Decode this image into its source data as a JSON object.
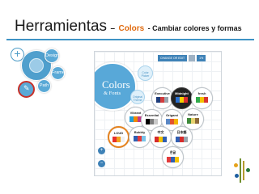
{
  "slide": {
    "title": "Herramientas",
    "dash": "–",
    "accent": "Colors",
    "subtitle": "- Cambiar colores y formas",
    "accent_color": "#e06b10",
    "rule_color": "#3e93c5"
  },
  "left_menu": {
    "plus_label": "+",
    "items": [
      {
        "label": "Design"
      },
      {
        "label": "Frame"
      },
      {
        "label": "Path"
      }
    ],
    "selected_icon": "brush-icon"
  },
  "app": {
    "toolbar": {
      "button_label": "CHANGE OR EDIT",
      "zoom": "1%"
    },
    "colors_panel": {
      "title": "Colors",
      "subtitle": "& Fonts"
    },
    "suggestions": [
      {
        "label": "Color Picker"
      },
      {
        "label": "Original Theme"
      }
    ],
    "themes": [
      {
        "name": "Executive",
        "swatches": [
          "#1f3c7a",
          "#d23c3c",
          "#9aa4ad"
        ]
      },
      {
        "name": "Midnight",
        "swatches": [
          "#2a6fd1",
          "#f5d000",
          "#e03030"
        ]
      },
      {
        "name": "fresh",
        "swatches": [
          "#2faa4a",
          "#f2c100",
          "#d8342f"
        ]
      },
      {
        "name": "Vibrant",
        "swatches": [
          "#22a0d8",
          "#f08a00",
          "#c23a8a"
        ]
      },
      {
        "name": "Essential",
        "swatches": [
          "#000000",
          "#7d7d7d",
          "#c9c9c9"
        ]
      },
      {
        "name": "Origami",
        "swatches": [
          "#5b87c4",
          "#e2532f",
          "#f3b400"
        ]
      },
      {
        "name": "Nature",
        "swatches": [
          "#3d8a3a",
          "#e6d26e",
          "#8d6a3a"
        ]
      },
      {
        "name": "LOUD",
        "swatches": [
          "#e8312a",
          "#f4a21c",
          "#ffffff"
        ]
      },
      {
        "name": "Bubbly",
        "swatches": [
          "#2f5fb2",
          "#e23b3b",
          "#7ac2e8"
        ]
      },
      {
        "name": "中文",
        "swatches": [
          "#d62b2b",
          "#f4c200",
          "#2f5fb2"
        ]
      },
      {
        "name": "日本語",
        "swatches": [
          "#2f5fb2",
          "#d62b2b",
          "#9aa4ad"
        ]
      },
      {
        "name": "한글",
        "swatches": [
          "#e23b3b",
          "#2f5fb2",
          "#f4c200"
        ]
      }
    ],
    "zoom_in": "+",
    "zoom_out": "−"
  }
}
